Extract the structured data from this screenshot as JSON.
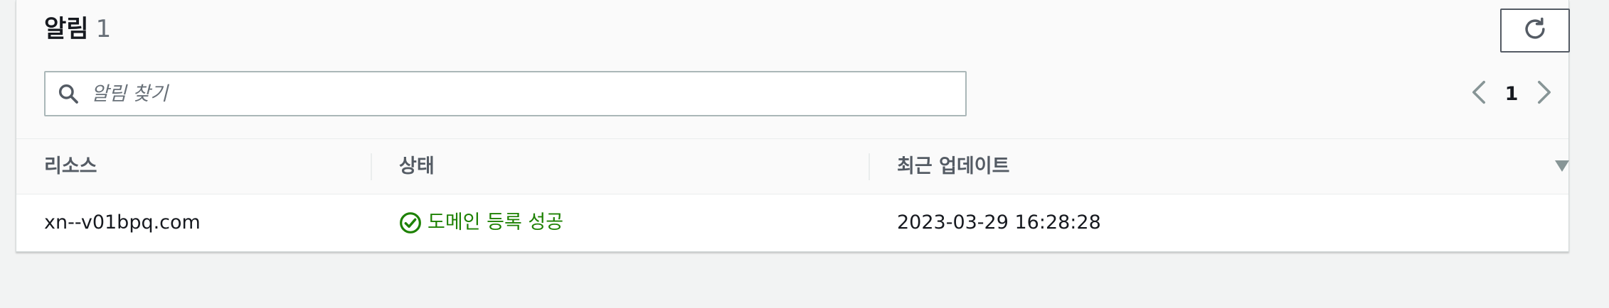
{
  "header": {
    "title": "알림",
    "count": "1",
    "refresh_icon": "refresh-icon"
  },
  "search": {
    "placeholder": "알림 찾기",
    "value": "",
    "icon": "search-icon"
  },
  "pagination": {
    "current_page": "1",
    "prev_icon": "chevron-left-icon",
    "next_icon": "chevron-right-icon"
  },
  "table": {
    "columns": [
      {
        "label": "리소스"
      },
      {
        "label": "상태"
      },
      {
        "label": "최근 업데이트"
      }
    ],
    "sort_icon": "caret-down-icon",
    "rows": [
      {
        "resource": "xn--v01bpq.com",
        "status": "도메인 등록 성공",
        "status_icon": "check-circle-icon",
        "updated": "2023-03-29 16:28:28"
      }
    ]
  },
  "colors": {
    "success": "#1d8102",
    "text": "#16191f",
    "muted": "#687078",
    "header_text": "#545b64",
    "border": "#aab7b8"
  }
}
